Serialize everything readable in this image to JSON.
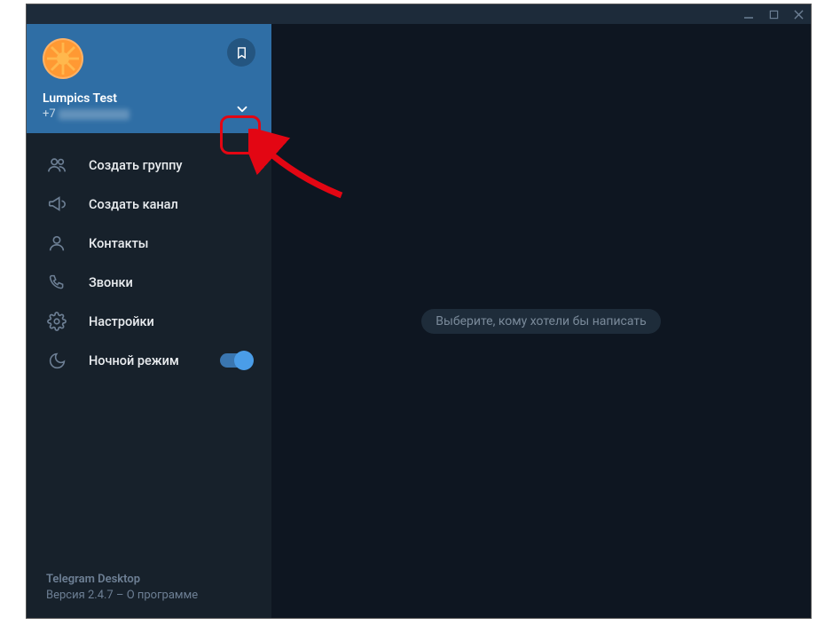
{
  "colors": {
    "accent": "#2f6ea5",
    "bg_dark": "#0e1621",
    "sidebar": "#17212b",
    "toggle_on": "#4a9de8",
    "highlight": "#e30613"
  },
  "profile": {
    "name": "Lumpics Test",
    "phone_prefix": "+7"
  },
  "menu": {
    "items": [
      {
        "icon": "group-icon",
        "label": "Создать группу"
      },
      {
        "icon": "megaphone-icon",
        "label": "Создать канал"
      },
      {
        "icon": "contact-icon",
        "label": "Контакты"
      },
      {
        "icon": "phone-icon",
        "label": "Звонки"
      },
      {
        "icon": "gear-icon",
        "label": "Настройки"
      },
      {
        "icon": "moon-icon",
        "label": "Ночной режим",
        "toggle": true
      }
    ]
  },
  "footer": {
    "app_name": "Telegram Desktop",
    "version_line": "Версия 2.4.7 – О программе"
  },
  "main": {
    "placeholder": "Выберите, кому хотели бы написать"
  }
}
